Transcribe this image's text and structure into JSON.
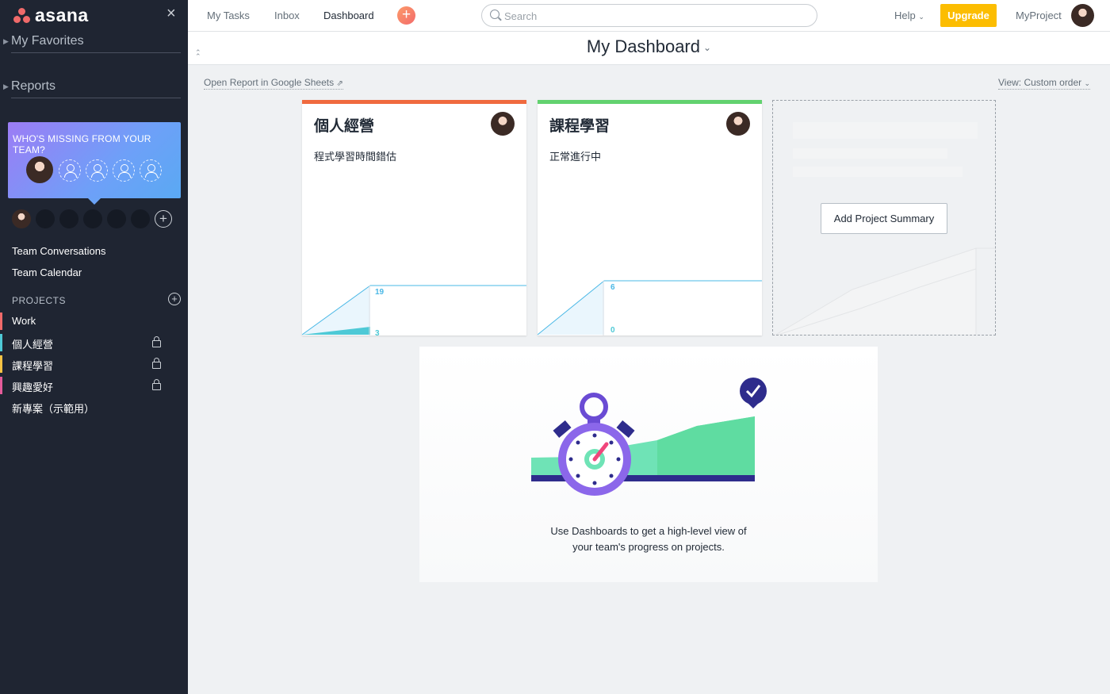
{
  "sidebar": {
    "logo_text": "asana",
    "close_label": "×",
    "favorites_label": "My Favorites",
    "reports_label": "Reports",
    "invite": {
      "title": "WHO'S MISSING FROM YOUR TEAM?"
    },
    "links": [
      {
        "label": "Team Conversations"
      },
      {
        "label": "Team Calendar"
      }
    ],
    "projects_label": "PROJECTS",
    "projects": [
      {
        "name": "Work",
        "color": "#f06a6a",
        "locked": false
      },
      {
        "name": "個人經營",
        "color": "#4ec9d6",
        "locked": true
      },
      {
        "name": "課程學習",
        "color": "#f8c344",
        "locked": true
      },
      {
        "name": "興趣愛好",
        "color": "#e45b9a",
        "locked": true
      },
      {
        "name": "新專案（示範用）",
        "color": "",
        "locked": false
      }
    ]
  },
  "topbar": {
    "nav": [
      {
        "label": "My Tasks"
      },
      {
        "label": "Inbox"
      },
      {
        "label": "Dashboard"
      }
    ],
    "quick_add": "+",
    "search_placeholder": "Search",
    "help_label": "Help",
    "upgrade_label": "Upgrade",
    "workspace_label": "MyProject"
  },
  "header": {
    "title": "My Dashboard"
  },
  "toolbar": {
    "open_report": "Open Report in Google Sheets",
    "view_order": "View: Custom order"
  },
  "cards": [
    {
      "title": "個人經營",
      "status": "程式學習時間錯估",
      "color": "#f06a3e",
      "total": 19,
      "done": 3
    },
    {
      "title": "課程學習",
      "status": "正常進行中",
      "color": "#62d26f",
      "total": 6,
      "done": 0
    }
  ],
  "placeholder_card": {
    "button_label": "Add Project Summary"
  },
  "promo": {
    "line1": "Use Dashboards to get a high-level view of",
    "line2": "your team's progress on projects."
  },
  "colors": {
    "sidebar_bg": "#1f2532",
    "accent_upgrade": "#fcbd01",
    "chart_line": "#4ab8e6",
    "chart_done": "#4ec9d6"
  }
}
